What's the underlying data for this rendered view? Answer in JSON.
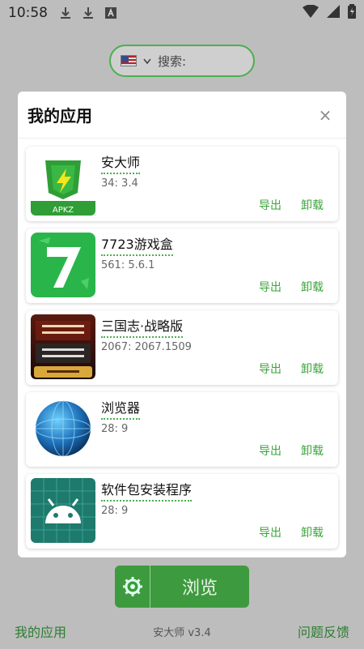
{
  "status_bar": {
    "time": "10:58",
    "extra_icons": [
      "download-icon",
      "download-icon",
      "a-icon"
    ],
    "right_icons": [
      "wifi-icon",
      "signal-icon",
      "battery-icon"
    ]
  },
  "search": {
    "flag": "us-flag-icon",
    "label": "搜索:"
  },
  "dialog": {
    "title": "我的应用",
    "close": "×",
    "apps": [
      {
        "name": "安大师",
        "version": "34: 3.4",
        "export": "导出",
        "uninstall": "卸载",
        "icon": "apkz-shield-icon"
      },
      {
        "name": "7723游戏盒",
        "version": "561: 5.6.1",
        "export": "导出",
        "uninstall": "卸载",
        "icon": "7723-icon"
      },
      {
        "name": "三国志·战略版",
        "version": "2067: 2067.1509",
        "export": "导出",
        "uninstall": "卸载",
        "icon": "sanguozhi-icon"
      },
      {
        "name": "浏览器",
        "version": "28: 9",
        "export": "导出",
        "uninstall": "卸载",
        "icon": "globe-icon"
      },
      {
        "name": "软件包安装程序",
        "version": "28: 9",
        "export": "导出",
        "uninstall": "卸载",
        "icon": "android-icon"
      }
    ]
  },
  "bottom": {
    "browse_label": "浏览",
    "gear": "gear-icon"
  },
  "footer": {
    "left": "我的应用",
    "version": "安大师 v3.4",
    "right": "问题反馈"
  },
  "colors": {
    "accent": "#4caf50",
    "button": "#3e9a3e",
    "link": "#2e7d32"
  }
}
